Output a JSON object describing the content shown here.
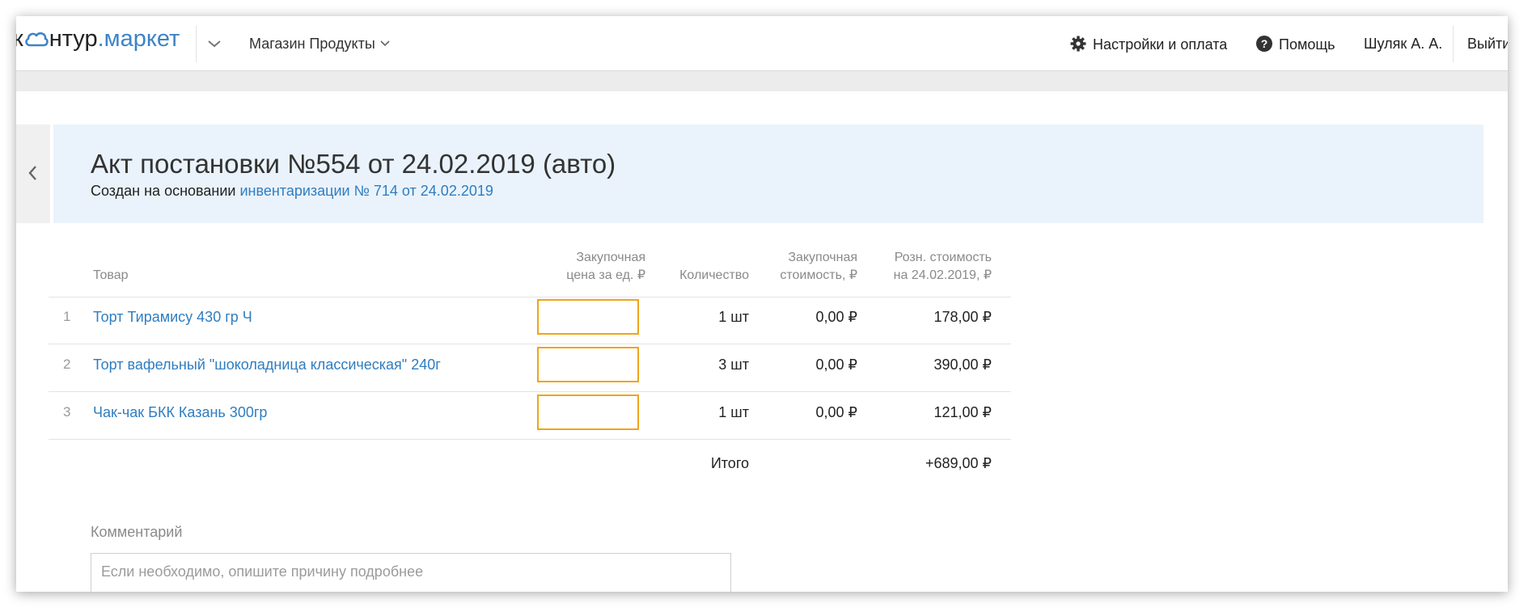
{
  "app": {
    "logo_k": "к",
    "logo_ntur": "нтур",
    "logo_market": ".маркет",
    "store_name": "Магазин Продукты",
    "settings_label": "Настройки и оплата",
    "help_label": "Помощь",
    "user_name": "Шуляк А. А.",
    "logout_label": "Выйти"
  },
  "document": {
    "title": "Акт постановки №554 от 24.02.2019 (авто)",
    "subtitle_prefix": "Создан на основании ",
    "subtitle_link": "инвентаризации № 714 от 24.02.2019"
  },
  "table": {
    "headers": {
      "product": "Товар",
      "purchase_price_1": "Закупочная",
      "purchase_price_2": "цена за ед. ₽",
      "quantity": "Количество",
      "purchase_cost_1": "Закупочная",
      "purchase_cost_2": "стоимость, ₽",
      "retail_cost_1": "Розн. стоимость",
      "retail_cost_2": "на 24.02.2019, ₽"
    },
    "rows": [
      {
        "n": "1",
        "product": "Торт Тирамису 430 гр Ч",
        "price": "",
        "qty": "1 шт",
        "cost": "0,00 ₽",
        "retail": "178,00 ₽"
      },
      {
        "n": "2",
        "product": "Торт вафельный \"шоколадница классическая\" 240г",
        "price": "",
        "qty": "3 шт",
        "cost": "0,00 ₽",
        "retail": "390,00 ₽"
      },
      {
        "n": "3",
        "product": "Чак-чак БКК Казань 300гр",
        "price": "",
        "qty": "1 шт",
        "cost": "0,00 ₽",
        "retail": "121,00 ₽"
      }
    ],
    "total_label": "Итого",
    "total_value": "+689,00 ₽"
  },
  "comment": {
    "label": "Комментарий",
    "placeholder": "Если необходимо, опишите причину подробнее"
  },
  "colors": {
    "link": "#2f7dc1",
    "accent_input_border": "#f0a418",
    "header_panel_bg": "#eaf3fb"
  },
  "icons": [
    "cloud-icon",
    "chevron-down-icon",
    "gear-icon",
    "help-icon",
    "chevron-left-icon"
  ]
}
